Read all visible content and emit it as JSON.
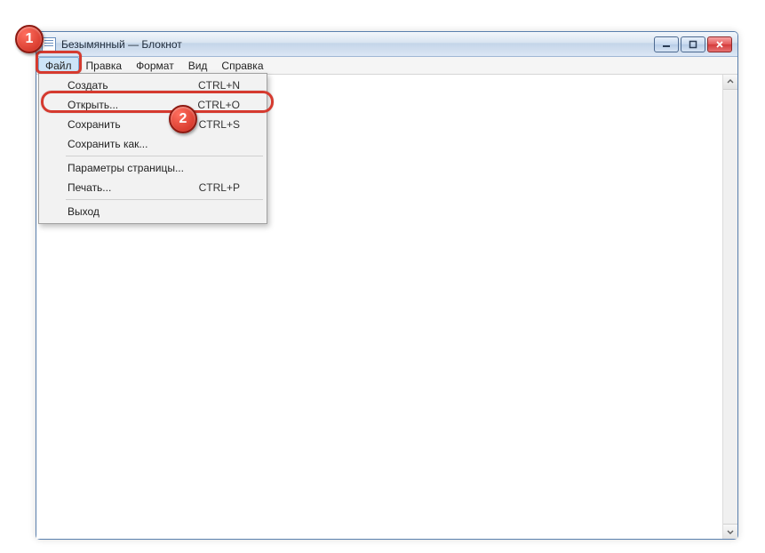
{
  "window": {
    "title": "Безымянный — Блокнот"
  },
  "menubar": {
    "file": "Файл",
    "edit": "Правка",
    "format": "Формат",
    "view": "Вид",
    "help": "Справка"
  },
  "file_menu": {
    "new": {
      "label": "Создать",
      "shortcut": "CTRL+N"
    },
    "open": {
      "label": "Открыть...",
      "shortcut": "CTRL+O"
    },
    "save": {
      "label": "Сохранить",
      "shortcut": "CTRL+S"
    },
    "saveas": {
      "label": "Сохранить как..."
    },
    "pagesetup": {
      "label": "Параметры страницы..."
    },
    "print": {
      "label": "Печать...",
      "shortcut": "CTRL+P"
    },
    "exit": {
      "label": "Выход"
    }
  },
  "annotations": {
    "badge1": "1",
    "badge2": "2"
  }
}
